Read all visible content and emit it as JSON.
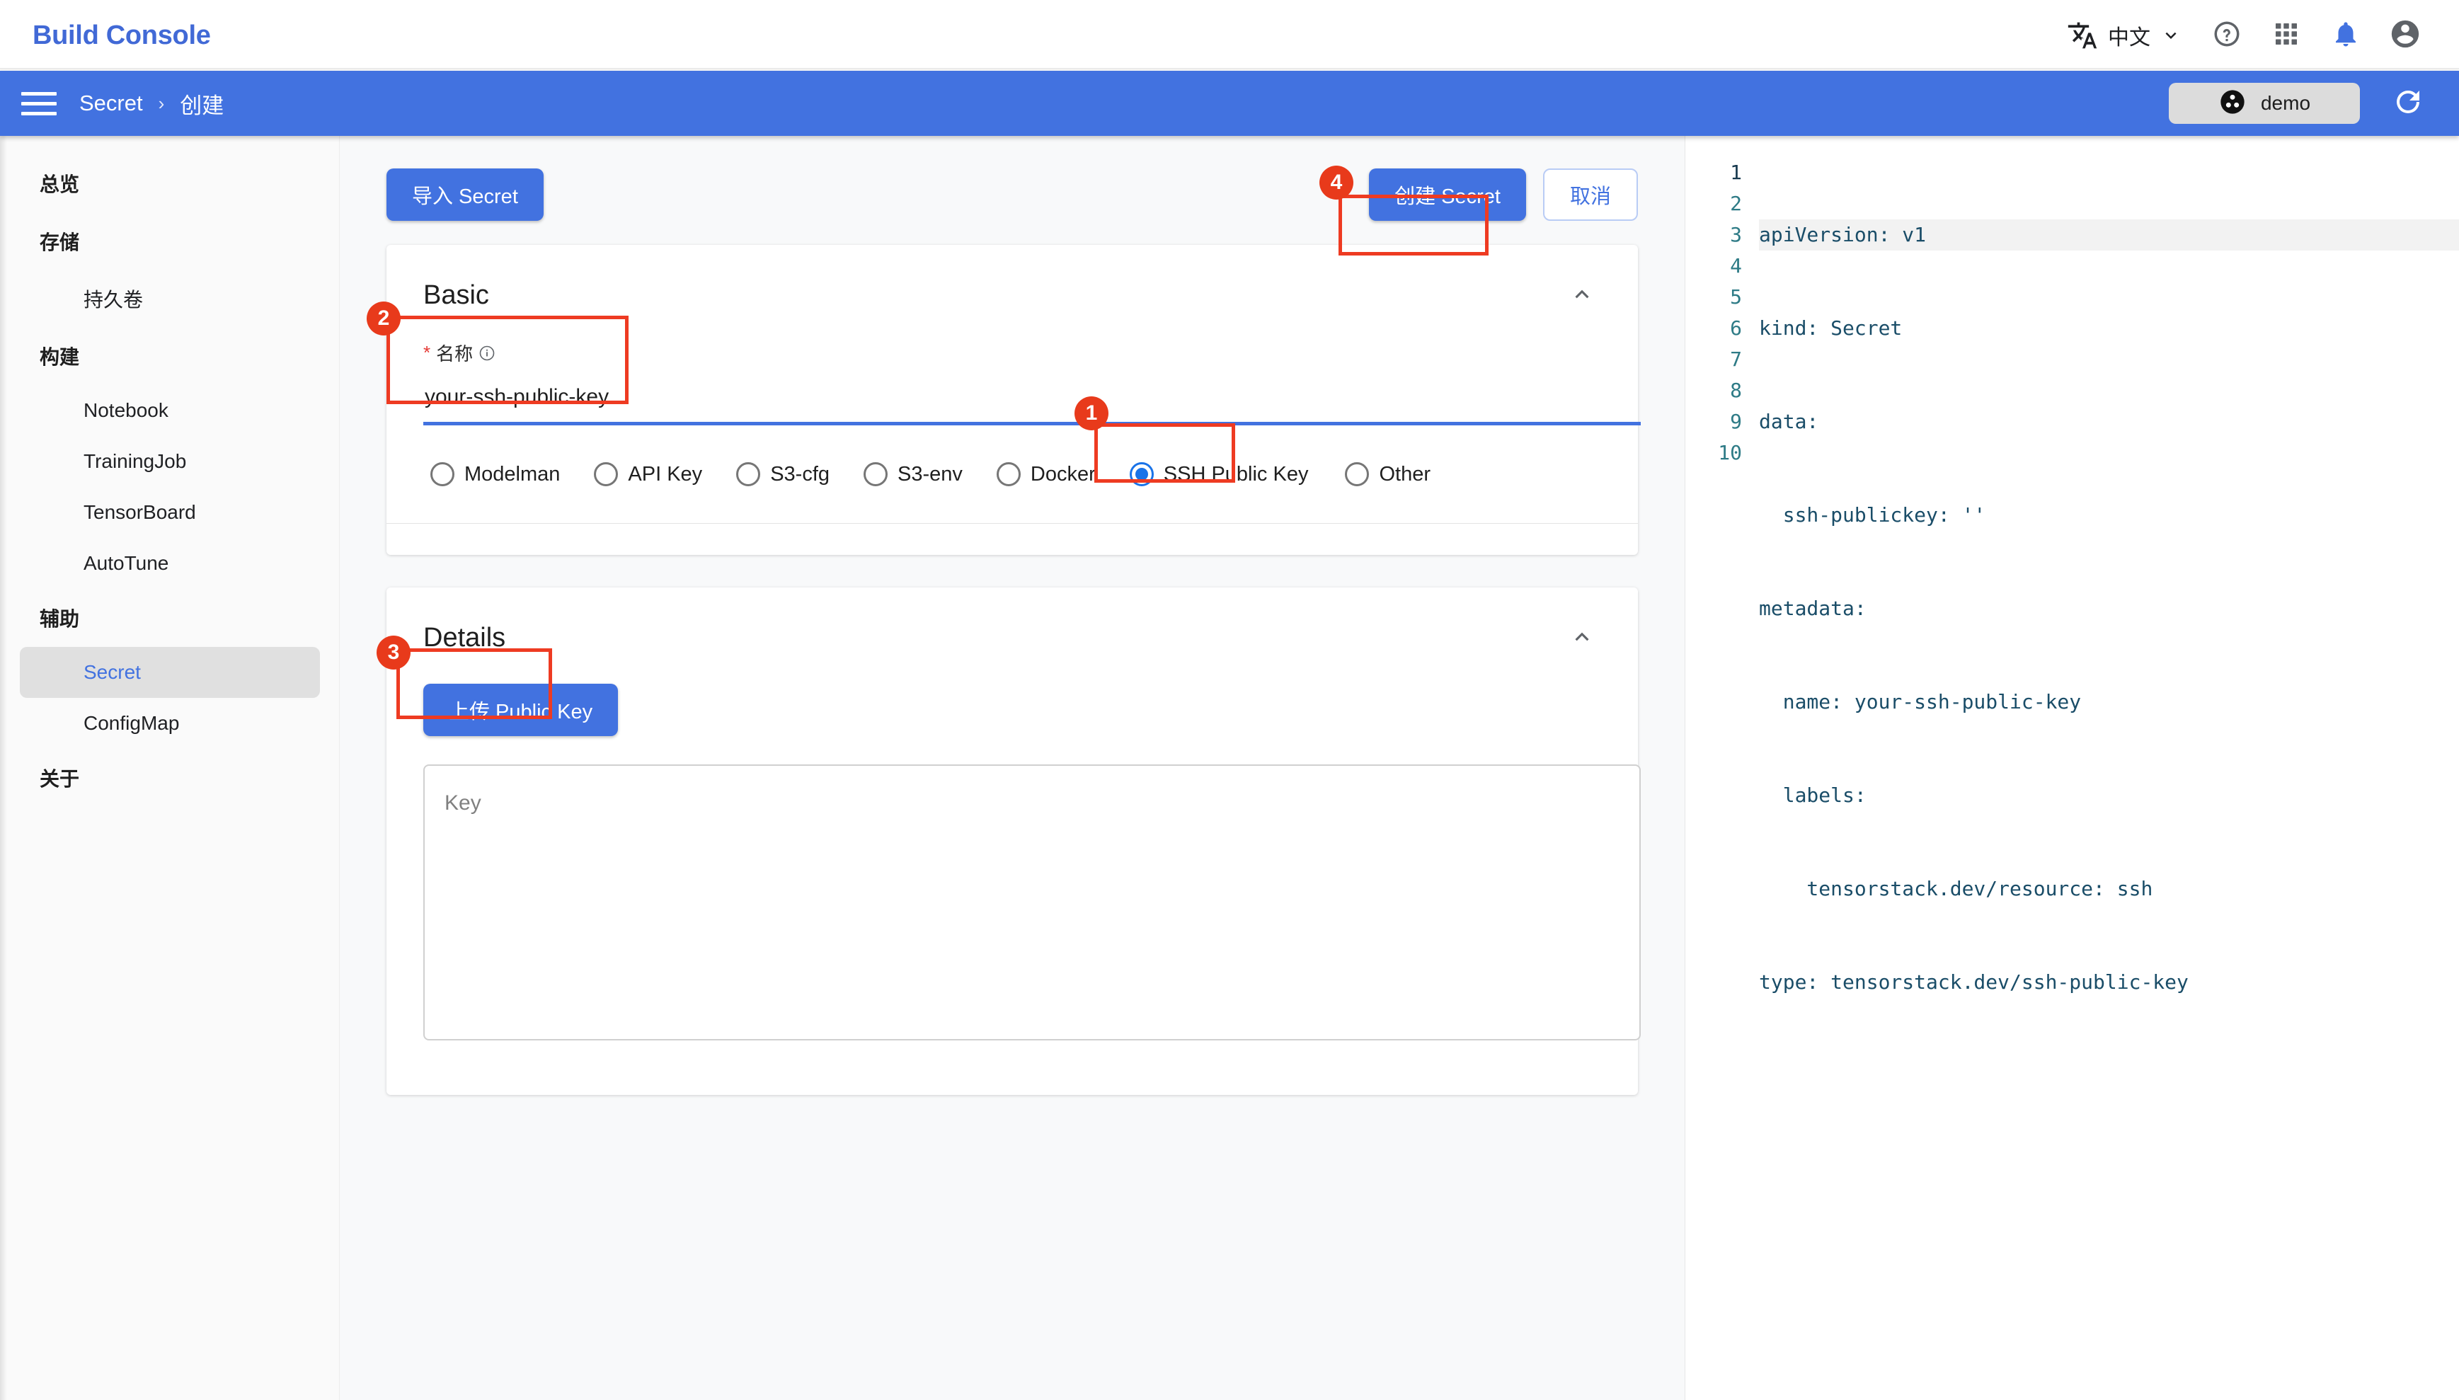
{
  "app": {
    "brand": "Build Console"
  },
  "header": {
    "lang_icon": "translate-icon",
    "lang_label": "中文",
    "chevron": "chevron-down-icon",
    "help_icon": "help-circle-icon",
    "apps_icon": "apps-grid-icon",
    "notifications_icon": "bell-icon",
    "account_icon": "account-circle-icon"
  },
  "breadcrumb": {
    "menu_icon": "hamburger-menu-icon",
    "items": [
      "Secret",
      "创建"
    ],
    "separator": "›",
    "namespace_chip": {
      "icon": "project-icon",
      "label": "demo"
    },
    "refresh_icon": "refresh-icon"
  },
  "sidebar": {
    "items": [
      {
        "label": "总览",
        "type": "group",
        "active": false
      },
      {
        "label": "存储",
        "type": "group",
        "active": false
      },
      {
        "label": "持久卷",
        "type": "item",
        "active": false
      },
      {
        "label": "构建",
        "type": "group",
        "active": false
      },
      {
        "label": "Notebook",
        "type": "item",
        "active": false
      },
      {
        "label": "TrainingJob",
        "type": "item",
        "active": false
      },
      {
        "label": "TensorBoard",
        "type": "item",
        "active": false
      },
      {
        "label": "AutoTune",
        "type": "item",
        "active": false
      },
      {
        "label": "辅助",
        "type": "group",
        "active": false
      },
      {
        "label": "Secret",
        "type": "item",
        "active": true
      },
      {
        "label": "ConfigMap",
        "type": "item",
        "active": false
      },
      {
        "label": "关于",
        "type": "group",
        "active": false
      }
    ]
  },
  "toolbar": {
    "import_label": "导入 Secret",
    "create_label": "创建 Secret",
    "cancel_label": "取消"
  },
  "annotations": {
    "one": "1",
    "two": "2",
    "three": "3",
    "four": "4"
  },
  "basic": {
    "title": "Basic",
    "collapse_icon": "chevron-up-icon",
    "name_field": {
      "required_mark": "*",
      "label": "名称",
      "info_icon": "info-circle-icon",
      "value": "your-ssh-public-key",
      "placeholder": "名称"
    },
    "type_options": [
      {
        "label": "Modelman",
        "checked": false
      },
      {
        "label": "API Key",
        "checked": false
      },
      {
        "label": "S3-cfg",
        "checked": false
      },
      {
        "label": "S3-env",
        "checked": false
      },
      {
        "label": "Docker",
        "checked": false
      },
      {
        "label": "SSH Public Key",
        "checked": true
      },
      {
        "label": "Other",
        "checked": false
      }
    ]
  },
  "details": {
    "title": "Details",
    "collapse_icon": "chevron-up-icon",
    "upload_label": "上传 Public Key",
    "key_placeholder": "Key",
    "key_value": ""
  },
  "yaml": {
    "line_numbers": [
      "1",
      "2",
      "3",
      "4",
      "5",
      "6",
      "7",
      "8",
      "9",
      "10"
    ],
    "lines": [
      "apiVersion: v1",
      "kind: Secret",
      "data:",
      "  ssh-publickey: ''",
      "metadata:",
      "  name: your-ssh-public-key",
      "  labels:",
      "    tensorstack.dev/resource: ssh",
      "type: tensorstack.dev/ssh-public-key",
      ""
    ]
  },
  "colors": {
    "brand_blue": "#4272e0",
    "accent_blue": "#1a73e8",
    "annotation_red": "#ee3b22",
    "sidebar_bg": "#fafafa",
    "page_bg": "#f8f9fa"
  }
}
